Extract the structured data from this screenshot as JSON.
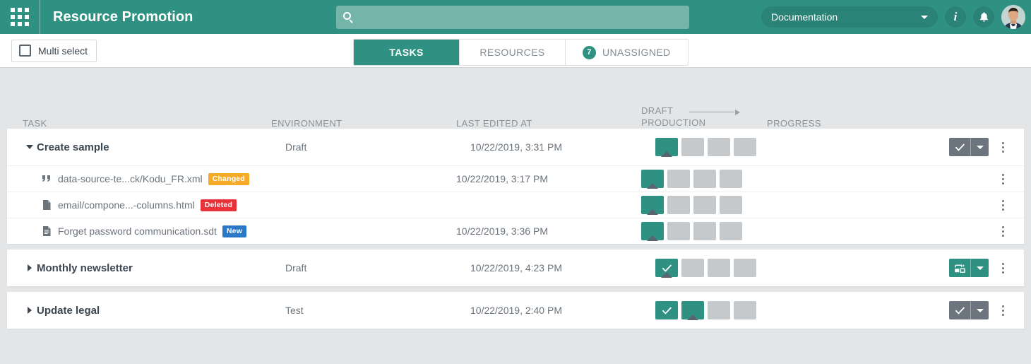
{
  "header": {
    "app_launcher_icon": "grid-apps-icon",
    "title": "Resource Promotion",
    "search": {
      "placeholder": "",
      "value": "",
      "icon": "search-icon"
    },
    "environment_select": {
      "value": "Documentation",
      "icon": "chevron-down-icon"
    },
    "info_button": {
      "label": "i",
      "icon": "info-icon"
    },
    "notifications_icon": "bell-icon",
    "avatar": "user-avatar",
    "bg_color": "#2e9182",
    "search_bg_color": "#74b5aa"
  },
  "subbar": {
    "multi_select": {
      "label": "Multi select",
      "checked": false
    },
    "tabs": [
      {
        "label": "TASKS",
        "active": true,
        "badge": null
      },
      {
        "label": "RESOURCES",
        "active": false,
        "badge": null
      },
      {
        "label": "UNASSIGNED",
        "active": false,
        "badge": "7"
      }
    ]
  },
  "table": {
    "columns": {
      "task": "TASK",
      "environment": "ENVIRONMENT",
      "last_edited": "LAST EDITED AT",
      "stage_from": "DRAFT",
      "stage_to": "PRODUCTION",
      "progress": "PROGRESS"
    },
    "groups": [
      {
        "expanded": true,
        "twisty": "triangle-down-icon",
        "task": "Create sample",
        "environment": "Draft",
        "last_edited": "10/22/2019, 3:31 PM",
        "stages": [
          {
            "state": "filled",
            "marker": true,
            "check": false
          },
          {
            "state": "empty",
            "marker": false,
            "check": false
          },
          {
            "state": "empty",
            "marker": false,
            "check": false
          },
          {
            "state": "empty",
            "marker": false,
            "check": false
          }
        ],
        "action": {
          "type": "approve",
          "icon": "check-icon",
          "color": "#6c757d"
        },
        "children": [
          {
            "icon": "quote-icon",
            "name": "data-source-te...ck/Kodu_FR.xml",
            "badge": {
              "label": "Changed",
              "color": "#f5ab28",
              "kind": "changed"
            },
            "last_edited": "10/22/2019, 3:17 PM",
            "stages": [
              {
                "state": "filled",
                "marker": true,
                "check": false
              },
              {
                "state": "empty",
                "marker": false,
                "check": false
              },
              {
                "state": "empty",
                "marker": false,
                "check": false
              },
              {
                "state": "empty",
                "marker": false,
                "check": false
              }
            ]
          },
          {
            "icon": "file-icon",
            "name": "email/compone...-columns.html",
            "badge": {
              "label": "Deleted",
              "color": "#e8333a",
              "kind": "deleted"
            },
            "last_edited": "",
            "stages": [
              {
                "state": "filled",
                "marker": true,
                "check": false
              },
              {
                "state": "empty",
                "marker": false,
                "check": false
              },
              {
                "state": "empty",
                "marker": false,
                "check": false
              },
              {
                "state": "empty",
                "marker": false,
                "check": false
              }
            ]
          },
          {
            "icon": "document-lines-icon",
            "name": "Forget password communication.sdt",
            "badge": {
              "label": "New",
              "color": "#2b78c8",
              "kind": "new"
            },
            "last_edited": "10/22/2019, 3:36 PM",
            "stages": [
              {
                "state": "filled",
                "marker": true,
                "check": false
              },
              {
                "state": "empty",
                "marker": false,
                "check": false
              },
              {
                "state": "empty",
                "marker": false,
                "check": false
              },
              {
                "state": "empty",
                "marker": false,
                "check": false
              }
            ]
          }
        ]
      },
      {
        "expanded": false,
        "twisty": "triangle-right-icon",
        "task": "Monthly newsletter",
        "environment": "Draft",
        "last_edited": "10/22/2019, 4:23 PM",
        "stages": [
          {
            "state": "filled",
            "marker": true,
            "check": true
          },
          {
            "state": "empty",
            "marker": false,
            "check": false
          },
          {
            "state": "empty",
            "marker": false,
            "check": false
          },
          {
            "state": "empty",
            "marker": false,
            "check": false
          }
        ],
        "action": {
          "type": "deploy",
          "icon": "deploy-icon",
          "color": "#2e9182"
        },
        "children": []
      },
      {
        "expanded": false,
        "twisty": "triangle-right-icon",
        "task": "Update legal",
        "environment": "Test",
        "last_edited": "10/22/2019, 2:40 PM",
        "stages": [
          {
            "state": "filled",
            "marker": false,
            "check": true
          },
          {
            "state": "filled",
            "marker": true,
            "check": false
          },
          {
            "state": "empty",
            "marker": false,
            "check": false
          },
          {
            "state": "empty",
            "marker": false,
            "check": false
          }
        ],
        "action": {
          "type": "approve",
          "icon": "check-icon",
          "color": "#6c757d"
        },
        "children": []
      }
    ]
  }
}
